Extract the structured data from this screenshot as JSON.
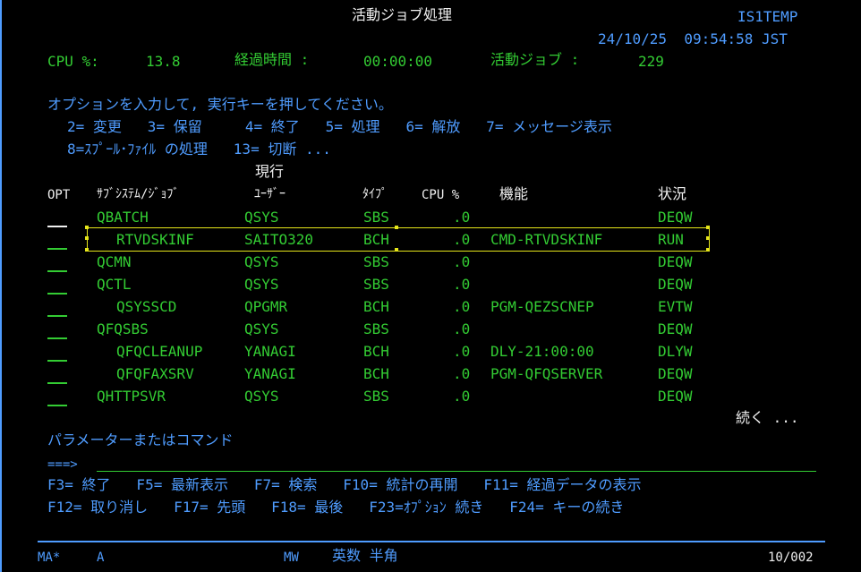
{
  "header": {
    "title": "活動ジョブ処理",
    "system": "IS1TEMP",
    "datetime": "24/10/25  09:54:58 JST",
    "cpu_label": "CPU %:",
    "cpu_value": "13.8",
    "elapsed_label": "経過時間 :",
    "elapsed_value": "00:00:00",
    "active_jobs_label": "活動ジョブ :",
    "active_jobs_value": "229"
  },
  "instructions": {
    "line1": "オプションを入力して, 実行キーを押してください。",
    "line2": "2= 変更   3= 保留     4= 終了   5= 処理   6= 解放   7= メッセージ表示",
    "line3": "8=ｽﾌﾟｰﾙ･ﾌｧｲﾙ の処理   13= 切断 ..."
  },
  "columns": {
    "current": "現行",
    "opt": "OPT",
    "subsystem_job": "ｻﾌﾞｼｽﾃﾑ/ｼﾞｮﾌﾞ",
    "user": "ﾕｰｻﾞｰ",
    "type": "ﾀｲﾌﾟ",
    "cpu": "CPU %",
    "function": "機能",
    "status": "状況"
  },
  "rows": [
    {
      "job": "QBATCH",
      "user": "QSYS",
      "type": "SBS",
      "cpu": ".0",
      "function": "",
      "status": "DEQW",
      "indent": 0
    },
    {
      "job": "RTVDSKINF",
      "user": "SAITO320",
      "type": "BCH",
      "cpu": ".0",
      "function": "CMD-RTVDSKINF",
      "status": "RUN",
      "indent": 1
    },
    {
      "job": "QCMN",
      "user": "QSYS",
      "type": "SBS",
      "cpu": ".0",
      "function": "",
      "status": "DEQW",
      "indent": 0
    },
    {
      "job": "QCTL",
      "user": "QSYS",
      "type": "SBS",
      "cpu": ".0",
      "function": "",
      "status": "DEQW",
      "indent": 0
    },
    {
      "job": "QSYSSCD",
      "user": "QPGMR",
      "type": "BCH",
      "cpu": ".0",
      "function": "PGM-QEZSCNEP",
      "status": "EVTW",
      "indent": 1
    },
    {
      "job": "QFQSBS",
      "user": "QSYS",
      "type": "SBS",
      "cpu": ".0",
      "function": "",
      "status": "DEQW",
      "indent": 0
    },
    {
      "job": "QFQCLEANUP",
      "user": "YANAGI",
      "type": "BCH",
      "cpu": ".0",
      "function": "DLY-21:00:00",
      "status": "DLYW",
      "indent": 1
    },
    {
      "job": "QFQFAXSRV",
      "user": "YANAGI",
      "type": "BCH",
      "cpu": ".0",
      "function": "PGM-QFQSERVER",
      "status": "DEQW",
      "indent": 1
    },
    {
      "job": "QHTTPSVR",
      "user": "QSYS",
      "type": "SBS",
      "cpu": ".0",
      "function": "",
      "status": "DEQW",
      "indent": 0
    }
  ],
  "more": "続く ...",
  "command": {
    "label": "パラメーターまたはコマンド",
    "prompt": "===>",
    "value": ""
  },
  "fkeys": {
    "line1": "F3= 終了   F5= 最新表示   F7= 検索   F10= 統計の再開   F11= 経過データの表示",
    "line2": "F12= 取り消し   F17= 先頭   F18= 最後   F23=ｵﾌﾟｼｮﾝ 続き   F24= キーの続き"
  },
  "status_bar": {
    "left": "MA*",
    "a": "A",
    "mw": "MW",
    "ime": "英数 半角",
    "position": "10/002"
  }
}
